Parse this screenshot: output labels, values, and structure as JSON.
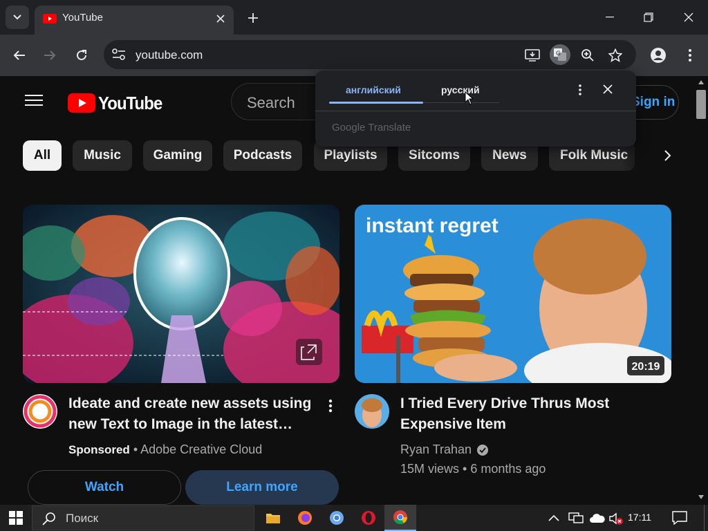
{
  "browser": {
    "tab_title": "YouTube",
    "url": "youtube.com"
  },
  "translate": {
    "source_lang": "английский",
    "target_lang": "русский",
    "branding": "Google Translate"
  },
  "masthead": {
    "logo_text": "YouTube",
    "search_placeholder": "Search",
    "signin_label": "Sign in"
  },
  "chips": [
    "All",
    "Music",
    "Gaming",
    "Podcasts",
    "Playlists",
    "Sitcoms",
    "News",
    "Folk Music"
  ],
  "videos": [
    {
      "title_line1": "Ideate and create new assets using",
      "title_line2": "new Text to Image in the latest…",
      "sponsored": "Sponsored",
      "channel": "Adobe Creative Cloud",
      "btn_watch": "Watch",
      "btn_learn": "Learn more"
    },
    {
      "thumb_text": "instant regret",
      "duration": "20:19",
      "title_line1": "I Tried Every Drive Thrus Most",
      "title_line2": "Expensive Item",
      "channel": "Ryan Trahan",
      "stats": "15M views • 6 months ago"
    }
  ],
  "taskbar": {
    "search_text": "Поиск",
    "time": "17:11"
  },
  "colors": {
    "accent": "#3ea6ff",
    "yt_red": "#ff0000",
    "chip_bg": "#272727",
    "page_bg": "#0f0f0f"
  }
}
